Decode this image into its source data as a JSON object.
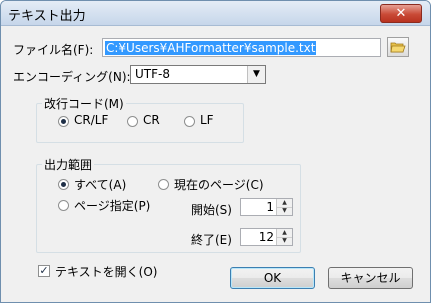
{
  "window": {
    "title": "テキスト出力",
    "close_glyph": "✕"
  },
  "file": {
    "label": "ファイル名(F):",
    "value": "C:¥Users¥AHFormatter¥sample.txt",
    "folder_icon": "folder-icon"
  },
  "encoding": {
    "label": "エンコーディング(N):",
    "selected": "UTF-8"
  },
  "newline": {
    "title": "改行コード(M)",
    "options": [
      {
        "label": "CR/LF",
        "selected": true
      },
      {
        "label": "CR",
        "selected": false
      },
      {
        "label": "LF",
        "selected": false
      }
    ]
  },
  "range": {
    "title": "出力範囲",
    "options": [
      {
        "label": "すべて(A)",
        "selected": true
      },
      {
        "label": "現在のページ(C)",
        "selected": false
      },
      {
        "label": "ページ指定(P)",
        "selected": false
      }
    ],
    "start_label": "開始(S)",
    "start_value": "1",
    "end_label": "終了(E)",
    "end_value": "12"
  },
  "open_text": {
    "label": "テキストを開く(O)",
    "checked": true,
    "check_glyph": "✓"
  },
  "buttons": {
    "ok": "OK",
    "cancel": "キャンセル"
  },
  "spin_glyphs": {
    "up": "▲",
    "down": "▼"
  },
  "select_arrow": "▼"
}
